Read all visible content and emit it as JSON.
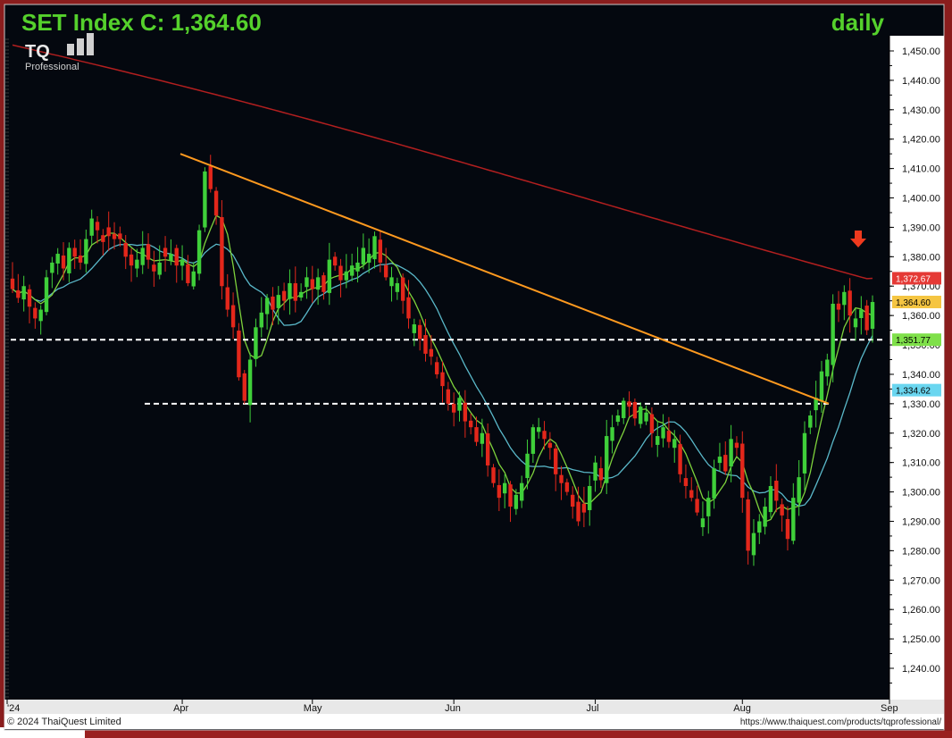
{
  "header": {
    "title": "SET Index C: 1,364.60",
    "timeframe": "daily",
    "logo_text": "TQ",
    "logo_sub": "Professional"
  },
  "footer": {
    "copyright": "© 2024 ThaiQuest Limited",
    "url": "https://www.thaiquest.com/products/tqprofessional/"
  },
  "price_labels": [
    {
      "value": 1372.67,
      "text": "1,372.67",
      "color": "#e53935",
      "text_color": "#ffffff"
    },
    {
      "value": 1364.6,
      "text": "1,364.60",
      "color": "#f5c542",
      "text_color": "#000000"
    },
    {
      "value": 1351.77,
      "text": "1,351.77",
      "color": "#7fe04a",
      "text_color": "#000000"
    },
    {
      "value": 1334.62,
      "text": "1,334.62",
      "color": "#6ad6f0",
      "text_color": "#000000"
    }
  ],
  "colors": {
    "background": "#04080f",
    "up": "#3fcf3a",
    "down": "#e3271b",
    "ma_long": "#b21f1f",
    "ma_mid": "#5ab8c9",
    "ma_short": "#7ed23c",
    "trendline": "#ff9a1f",
    "arrow": "#f03a1e",
    "title": "#55d12c"
  },
  "chart_data": {
    "type": "candlestick",
    "title": "SET Index C: 1,364.60",
    "ylim": [
      1230,
      1455
    ],
    "y_ticks": [
      1240,
      1250,
      1260,
      1270,
      1280,
      1290,
      1300,
      1310,
      1320,
      1330,
      1340,
      1350,
      1360,
      1370,
      1380,
      1390,
      1400,
      1410,
      1420,
      1430,
      1440,
      1450
    ],
    "y_tick_labels": [
      "1,240.00",
      "1,250.00",
      "1,260.00",
      "1,270.00",
      "1,280.00",
      "1,290.00",
      "1,300.00",
      "1,310.00",
      "1,320.00",
      "1,330.00",
      "1,340.00",
      "1,350.00",
      "1,360.00",
      "1,370.00",
      "1,380.00",
      "1,390.00",
      "1,400.00",
      "1,410.00",
      "1,420.00",
      "1,430.00",
      "1,440.00",
      "1,450.00"
    ],
    "x_labels": [
      {
        "label": "'24",
        "index": 0
      },
      {
        "label": "Apr",
        "index": 30
      },
      {
        "label": "May",
        "index": 53
      },
      {
        "label": "Jun",
        "index": 78
      },
      {
        "label": "Jul",
        "index": 103
      },
      {
        "label": "Aug",
        "index": 129
      },
      {
        "label": "Sep",
        "index": 155
      }
    ],
    "closes": [
      1369,
      1366,
      1370,
      1363,
      1359,
      1362,
      1373,
      1378,
      1381,
      1376,
      1383,
      1380,
      1378,
      1386,
      1393,
      1389,
      1385,
      1387,
      1386,
      1386,
      1380,
      1377,
      1379,
      1383,
      1379,
      1375,
      1378,
      1380,
      1381,
      1377,
      1379,
      1371,
      1375,
      1389,
      1409,
      1403,
      1394,
      1370,
      1362,
      1356,
      1339,
      1331,
      1345,
      1356,
      1361,
      1366,
      1362,
      1367,
      1365,
      1371,
      1365,
      1368,
      1373,
      1369,
      1373,
      1368,
      1379,
      1377,
      1372,
      1375,
      1377,
      1378,
      1383,
      1381,
      1387,
      1378,
      1373,
      1373,
      1371,
      1365,
      1359,
      1357,
      1352,
      1347,
      1346,
      1340,
      1336,
      1330,
      1327,
      1332,
      1324,
      1322,
      1317,
      1320,
      1309,
      1303,
      1298,
      1303,
      1295,
      1299,
      1303,
      1313,
      1322,
      1322,
      1318,
      1315,
      1306,
      1303,
      1300,
      1295,
      1290,
      1293,
      1302,
      1310,
      1304,
      1319,
      1322,
      1326,
      1331,
      1329,
      1325,
      1329,
      1327,
      1320,
      1319,
      1322,
      1317,
      1318,
      1306,
      1302,
      1298,
      1293,
      1291,
      1298,
      1308,
      1312,
      1307,
      1318,
      1315,
      1298,
      1280,
      1286,
      1290,
      1295,
      1302,
      1297,
      1292,
      1284,
      1298,
      1305,
      1320,
      1326,
      1332,
      1341,
      1345,
      1364,
      1362,
      1368,
      1360,
      1359,
      1362,
      1355,
      1364.6
    ],
    "moving_averages": [
      {
        "period": "long",
        "last_value": 1372.67
      },
      {
        "period": "short",
        "last_value": 1351.77
      },
      {
        "period": "mid",
        "last_value": 1334.62
      }
    ],
    "support_lines": [
      1351.77,
      1330
    ],
    "trendline": {
      "from": {
        "index": 23,
        "value": 1415
      },
      "to": {
        "index": 124,
        "value": 1330
      }
    },
    "annotation": "down-arrow at latest bar"
  }
}
